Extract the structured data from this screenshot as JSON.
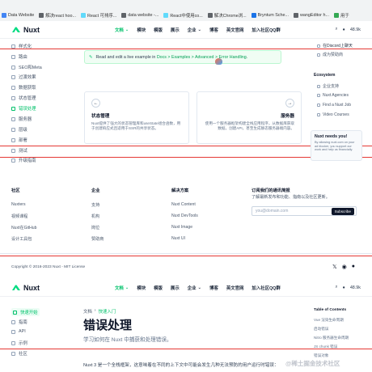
{
  "bookmarks": [
    {
      "label": "Data Website",
      "color": "#4285f4"
    },
    {
      "label": "解决react hoo...",
      "color": "#5f6368"
    },
    {
      "label": "React 可排序...",
      "color": "#61dafb"
    },
    {
      "label": "data website -...",
      "color": "#5f6368"
    },
    {
      "label": "React中使用co...",
      "color": "#61dafb"
    },
    {
      "label": "解决Chrome浏...",
      "color": "#5f6368"
    },
    {
      "label": "Bryntum Sche...",
      "color": "#1a73e8"
    },
    {
      "label": "wangEditor h...",
      "color": "#5f6368"
    },
    {
      "label": "用于",
      "color": "#34a853"
    }
  ],
  "header": {
    "logo": "Nuxt",
    "nav": [
      "文档",
      "模块",
      "模版",
      "展示",
      "企业",
      "博客",
      "英文官网",
      "加入社区QQ群"
    ],
    "github_stars": "48.9k"
  },
  "sidebar_mid": [
    "样式化",
    "SEO和Meta",
    "过渡效果",
    "数据获取",
    "状态管理",
    "错误处理",
    "服务器",
    "层级",
    "部署",
    "测试",
    "升级指南"
  ],
  "sidebar_mid_active": "错误处理",
  "sidebar_mid_partial": "路由",
  "tip": {
    "prefix": "Read and edit a live example in ",
    "link": "Docs > Examples > Advanced > Error Handling",
    "suffix": "."
  },
  "cards": [
    {
      "arrow": "←",
      "title": "状态管理",
      "desc": "Nuxt提供了强大的状态管理库和useState组合函数，用于创建响应式且适用于SSR的共享状态。"
    },
    {
      "arrow": "→",
      "title": "服务器",
      "desc": "使用一个服务器框架构建全栈应用程序，从数据库获取数据，创建API，甚至生成静态服务器端内容。"
    }
  ],
  "right_sidebar": {
    "top_links": [
      "在Discord上聊天",
      "成为赞助商"
    ],
    "eco_title": "Ecosystem",
    "eco_links": [
      "企业支持",
      "Nuxt Agencies",
      "Find a Nuxt Job",
      "Video Courses"
    ]
  },
  "promo": {
    "title": "Nuxt needs you!",
    "desc": "By allowing nuxt.com on your ad blocker, you support our work and help us financially."
  },
  "footer": {
    "cols": [
      {
        "title": "社区",
        "links": [
          "Nuxters",
          "视频课程",
          "Nuxt在GitHub",
          "设计工具包"
        ]
      },
      {
        "title": "企业",
        "links": [
          "支持",
          "机构",
          "岗位",
          "赞助商"
        ]
      },
      {
        "title": "解决方案",
        "links": [
          "Nuxt Content",
          "Nuxt DevTools",
          "Nuxt Image",
          "Nuxt UI"
        ]
      }
    ],
    "newsletter_title": "订阅我们的通讯简报",
    "newsletter_desc": "了解最新发布和功能、指南以及社区更新。",
    "email_placeholder": "you@domain.com",
    "subscribe_label": "Subscribe",
    "copyright": "Copyright © 2016-2023 Nuxt - MIT License"
  },
  "sidebar_bottom": [
    "快速开始",
    "指南",
    "API",
    "示例",
    "社区"
  ],
  "page": {
    "breadcrumb": [
      "文档",
      "快速入门"
    ],
    "title": "错误处理",
    "lead": "学习如何在 Nuxt 中捕获和处理错误。",
    "body": "Nuxt 3 是一个全栈框架，这意味着在不同的上下文中可能会发生几种无法预防的用户运行时错误："
  },
  "toc": {
    "title": "Table of Contents",
    "items": [
      "Vue 渲染生命周期",
      "启动错误",
      "Nitro 服务器生命周期",
      "JS chunk 错误",
      "错误对象"
    ]
  },
  "watermark": "@稀土掘金技术社区",
  "colors": {
    "accent": "#00c16a",
    "divider": "#e53935"
  }
}
